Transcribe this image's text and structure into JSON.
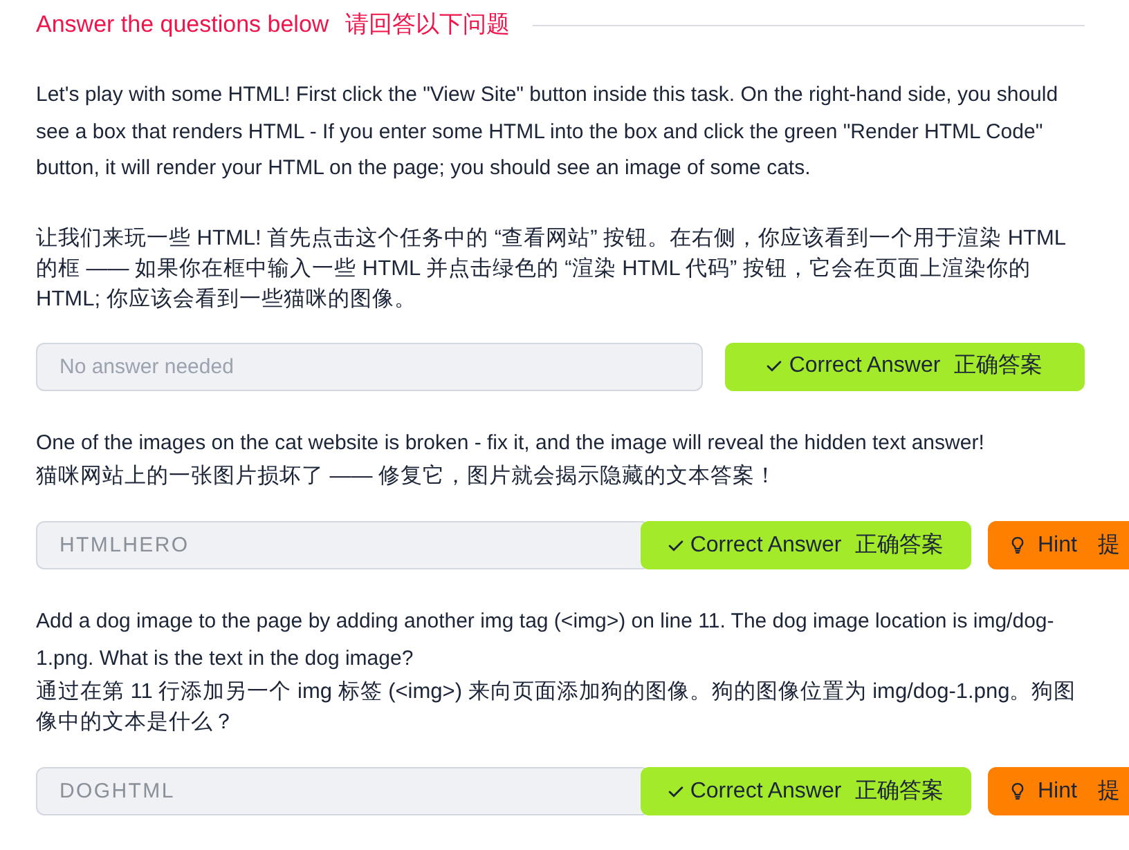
{
  "section": {
    "title": "Answer the questions below",
    "title_translation": "请回答以下问题"
  },
  "questions": [
    {
      "paragraphs": [
        [
          {
            "kind": "en",
            "text": "Let's play with some HTML! First click the \"View Site\" button inside this task. On the right-hand side, you should see a box that renders HTML - If you enter some HTML into the box and click the green \"Render HTML Code\" button, it will render your HTML on the page; you should see an image of some cats."
          }
        ],
        [
          {
            "kind": "zh",
            "text": "让我们来玩一些 HTML! 首先点击这个任务中的 “查看网站” 按钮。在右侧，你应该看到一个用于渲染 HTML 的框 —— 如果你在框中输入一些 HTML 并点击绿色的 “渲染 HTML 代码” 按钮，它会在页面上渲染你的 HTML; 你应该会看到一些猫咪的图像。"
          }
        ]
      ],
      "answer": {
        "placeholder": "No answer needed"
      },
      "buttons": [
        {
          "kind": "correct",
          "label": "Correct Answer",
          "label_translation": "正确答案"
        }
      ]
    },
    {
      "paragraphs": [
        [
          {
            "kind": "en",
            "text": "One of the images on the cat website is broken - fix it, and the image will reveal the hidden text answer!"
          },
          {
            "kind": "zh",
            "text": "猫咪网站上的一张图片损坏了 —— 修复它，图片就会揭示隐藏的文本答案！"
          }
        ]
      ],
      "answer": {
        "value": "HTMLHERO"
      },
      "buttons": [
        {
          "kind": "correct",
          "label": "Correct Answer",
          "label_translation": "正确答案"
        },
        {
          "kind": "hint",
          "label": "Hint",
          "label_translation": "提"
        }
      ]
    },
    {
      "paragraphs": [
        [
          {
            "kind": "en",
            "text": "Add a dog image to the page by adding another img tag (<img>) on line 11. The dog image location is img/dog-1.png. What is the text in the dog image?"
          },
          {
            "kind": "zh",
            "text": "通过在第 11 行添加另一个 img 标签 (<img>) 来向页面添加狗的图像。狗的图像位置为 img/dog-1.png。狗图像中的文本是什么？"
          }
        ]
      ],
      "answer": {
        "value": "DOGHTML"
      },
      "buttons": [
        {
          "kind": "correct",
          "label": "Correct Answer",
          "label_translation": "正确答案"
        },
        {
          "kind": "hint",
          "label": "Hint",
          "label_translation": "提"
        }
      ]
    }
  ]
}
